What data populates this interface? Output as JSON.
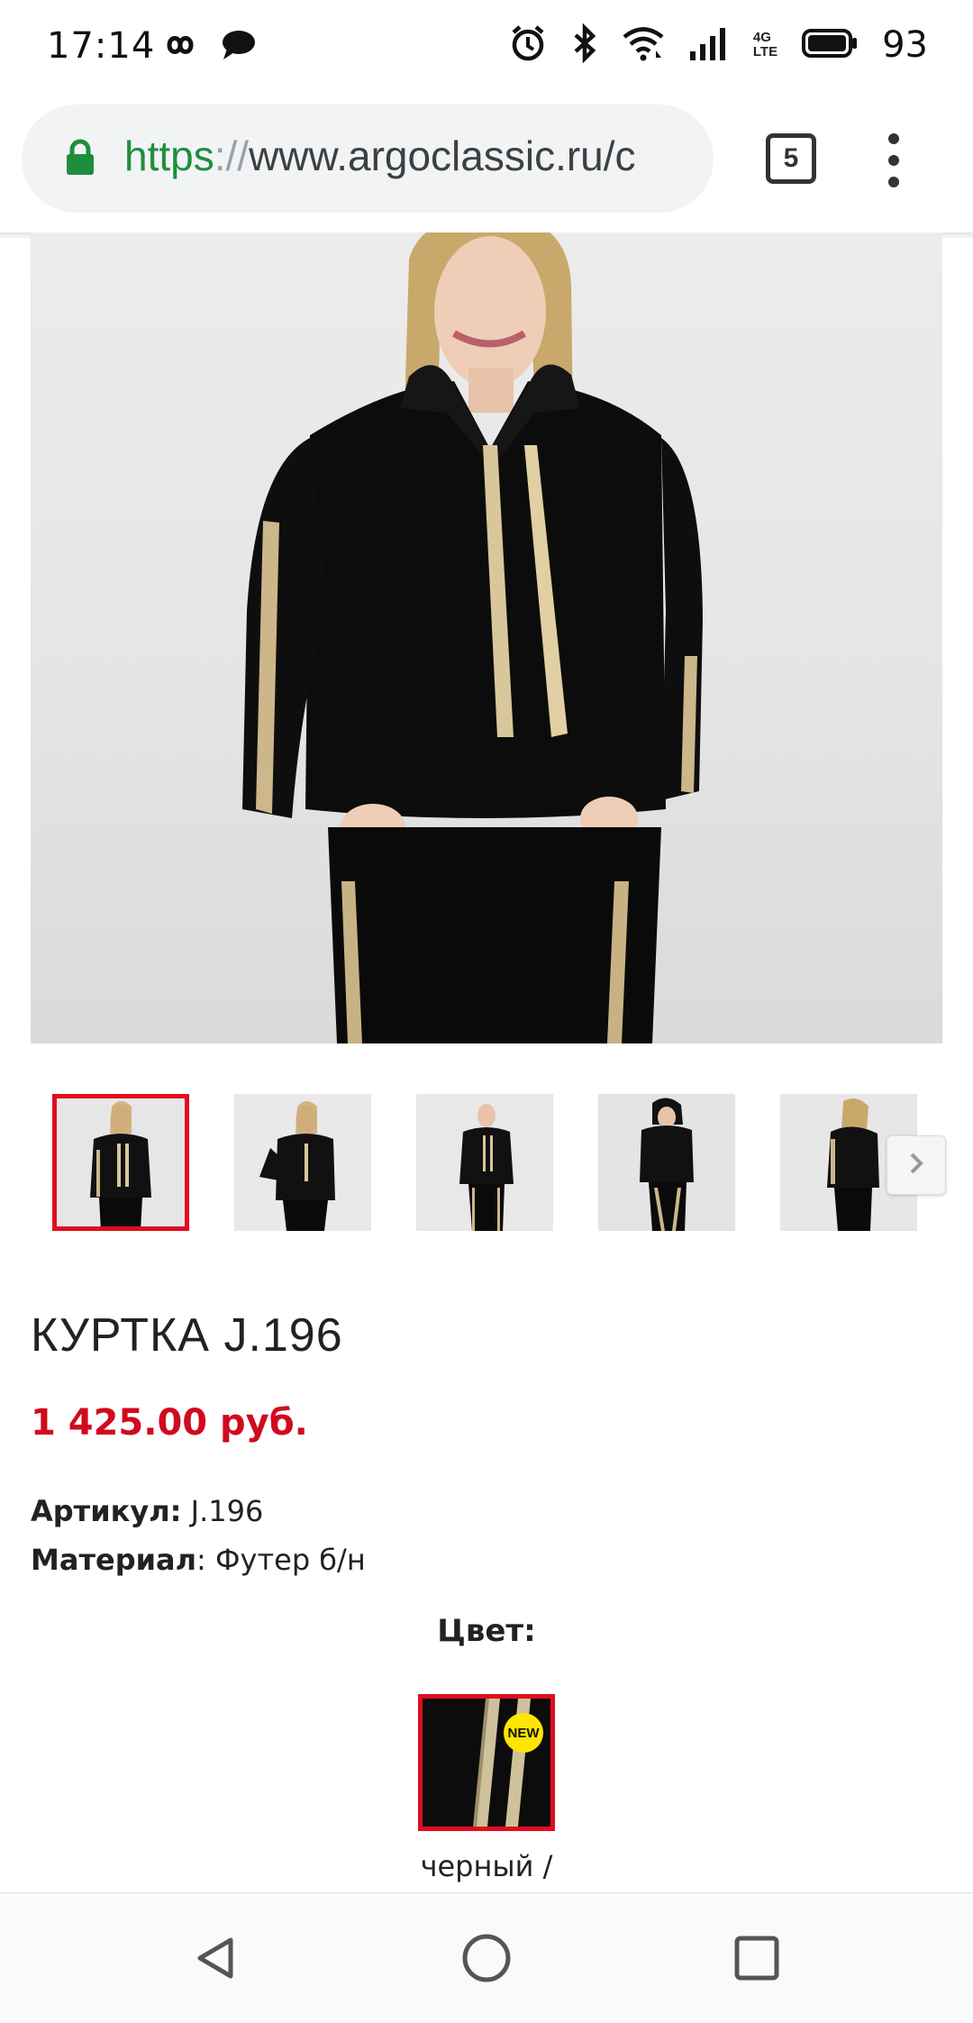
{
  "status_bar": {
    "time": "17:14",
    "network_label": "4G\nLTE",
    "battery_percent": "93",
    "icons": [
      "infinity-icon",
      "chat-bubble-icon",
      "alarm-icon",
      "bluetooth-icon",
      "wifi-icon",
      "signal-icon",
      "battery-icon"
    ]
  },
  "browser": {
    "url_scheme": "https",
    "url_sep": "://",
    "url_host": "www.argoclassic.ru/c",
    "tab_count": "5"
  },
  "gallery": {
    "thumbnail_count": 5,
    "active_index": 0
  },
  "product": {
    "title": "КУРТКА J.196",
    "price": "1 425.00 руб.",
    "article_label": "Артикул:",
    "article_value": " J.196",
    "material_label": "Материал",
    "material_value": ": Футер б/н",
    "color_heading": "Цвет:",
    "color_badge": "NEW",
    "color_name": "черный /"
  },
  "colors": {
    "accent": "#e10d1f",
    "price": "#d10a1e",
    "badge": "#ffe600",
    "url_scheme": "#1e8e3e"
  }
}
